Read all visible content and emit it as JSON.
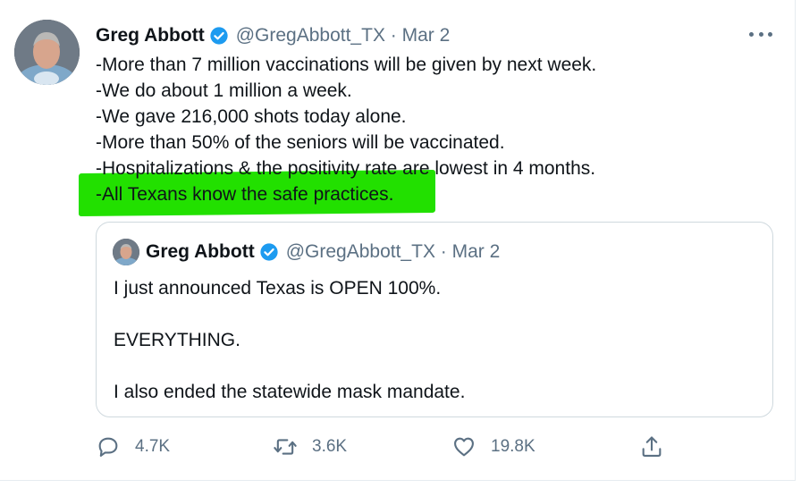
{
  "tweet": {
    "author_name": "Greg Abbott",
    "handle_date": "@GregAbbott_TX · Mar 2",
    "lines": [
      "-More than 7 million vaccinations will be given by next week.",
      "-We do about 1 million a week.",
      "-We gave 216,000 shots today alone.",
      "-More than 50% of the seniors will be vaccinated.",
      "-Hospitalizations & the positivity rate are lowest in 4 months.",
      "-All Texans know the safe practices."
    ],
    "highlight_color": "#22e000"
  },
  "quote": {
    "author_name": "Greg Abbott",
    "handle_date": "@GregAbbott_TX · Mar 2",
    "lines": [
      "I just announced Texas is OPEN 100%.",
      "EVERYTHING.",
      "I also ended the statewide mask mandate."
    ]
  },
  "actions": {
    "reply_count": "4.7K",
    "retweet_count": "3.6K",
    "like_count": "19.8K"
  },
  "icons": {
    "verified": "verified-badge-icon",
    "more": "more-options-icon",
    "reply": "reply-icon",
    "retweet": "retweet-icon",
    "like": "like-icon",
    "share": "share-icon"
  },
  "colors": {
    "brand_blue": "#1d9bf0",
    "secondary_text": "#5b7083",
    "primary_text": "#0f1419",
    "border": "#cfd9de"
  }
}
